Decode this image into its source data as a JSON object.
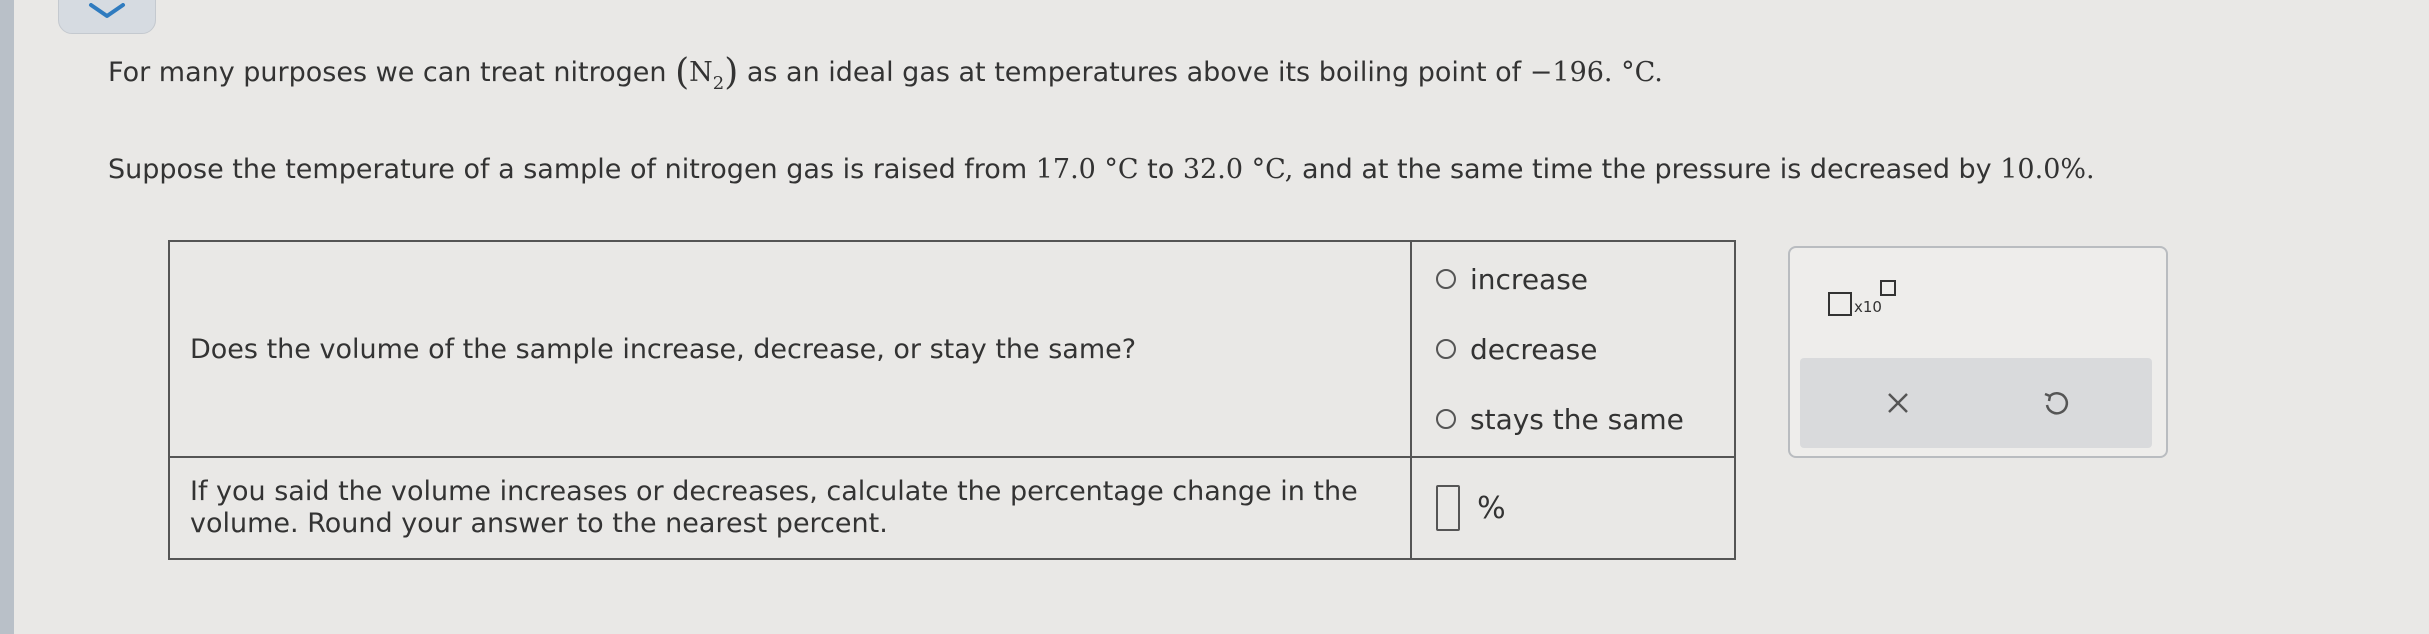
{
  "intro": {
    "part1": "For many purposes we can treat nitrogen",
    "formula_element": "N",
    "formula_subscript": "2",
    "part2": "as an ideal gas at temperatures above its boiling point of",
    "boiling_point": "−196. °C."
  },
  "scenario": {
    "part1": "Suppose the temperature of a sample of nitrogen gas is raised from",
    "t_start": "17.0 °C",
    "to": "to",
    "t_end": "32.0 °C,",
    "part2": "and at the same time the pressure is decreased by",
    "pressure_change": "10.0%."
  },
  "question1": {
    "text": "Does the volume of the sample increase, decrease, or stay the same?",
    "options": [
      "increase",
      "decrease",
      "stays the same"
    ]
  },
  "question2": {
    "text": "If you said the volume increases or decreases, calculate the percentage change in the volume. Round your answer to the nearest percent.",
    "answer_value": "",
    "unit": "%"
  },
  "tools": {
    "sci_label": "x10",
    "clear_icon": "close-icon",
    "undo_icon": "undo-icon"
  }
}
